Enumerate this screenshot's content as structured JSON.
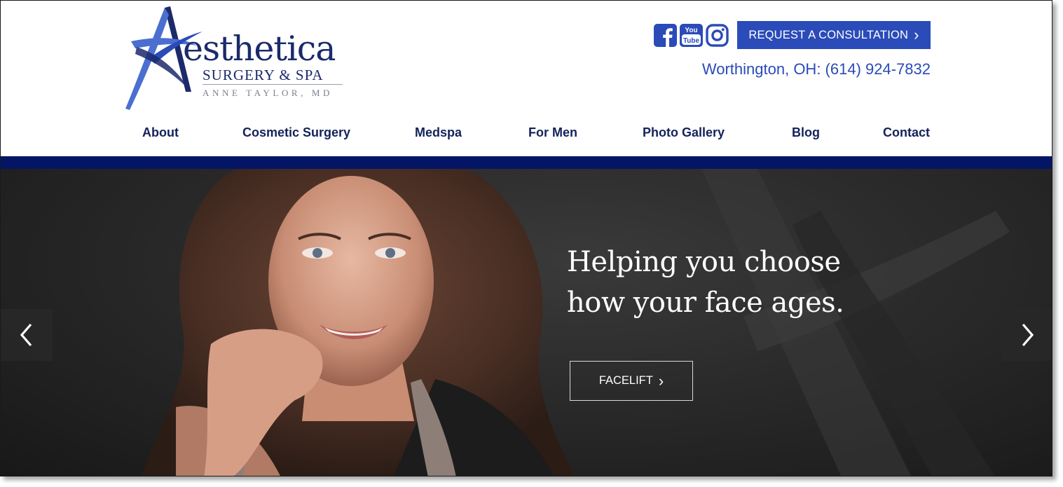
{
  "logo": {
    "wordmark": "esthetica",
    "subtitle": "SURGERY & SPA",
    "doctor": "ANNE TAYLOR, MD",
    "brand_color": "#1b2a6b",
    "accent_color": "#4a6fd1"
  },
  "social": [
    {
      "name": "facebook",
      "icon": "facebook-icon"
    },
    {
      "name": "youtube",
      "icon": "youtube-icon",
      "text_top": "You",
      "text_bottom": "Tube"
    },
    {
      "name": "instagram",
      "icon": "instagram-icon"
    }
  ],
  "header": {
    "cta_label": "REQUEST A CONSULTATION",
    "cta_chevron": "›",
    "cta_color": "#2b4bb9",
    "phone": "Worthington, OH: (614) 924-7832"
  },
  "nav": {
    "items": [
      {
        "label": "About"
      },
      {
        "label": "Cosmetic Surgery"
      },
      {
        "label": "Medspa"
      },
      {
        "label": "For Men"
      },
      {
        "label": "Photo Gallery"
      },
      {
        "label": "Blog"
      },
      {
        "label": "Contact"
      }
    ],
    "band_color": "#051565"
  },
  "hero": {
    "headline_line1": "Helping you choose",
    "headline_line2": "how your face ages.",
    "button_label": "FACELIFT",
    "button_chevron": "›",
    "prev_icon": "chevron-left-icon",
    "next_icon": "chevron-right-icon"
  }
}
